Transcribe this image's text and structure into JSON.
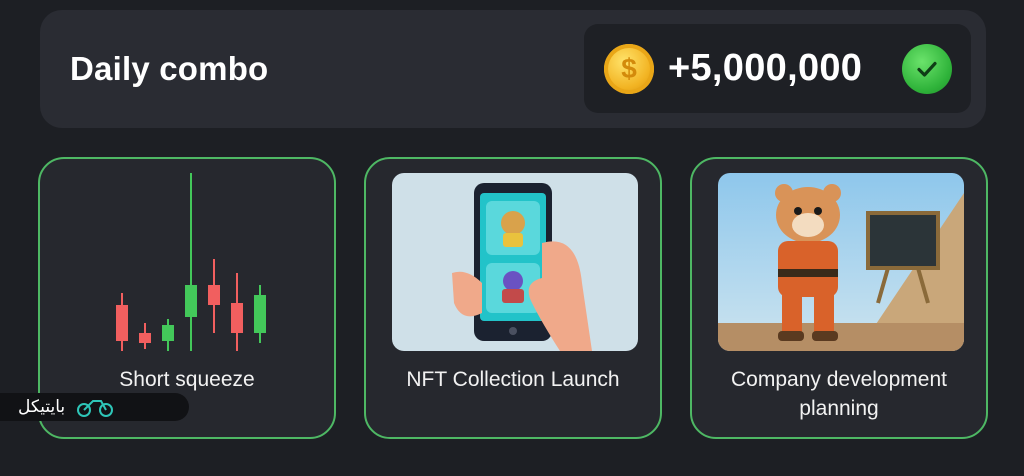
{
  "header": {
    "title": "Daily combo",
    "reward_amount": "+5,000,000",
    "coin_icon": "dollar-coin-icon",
    "status_icon": "check-circle-icon",
    "status_color": "#3cc24a"
  },
  "cards": [
    {
      "label": "Short squeeze",
      "image": "candlestick-chart"
    },
    {
      "label": "NFT Collection Launch",
      "image": "phone-nft-illustration"
    },
    {
      "label": "Company development planning",
      "image": "hamster-ceo-illustration"
    }
  ],
  "colors": {
    "accent_border": "#4eb864",
    "candle_up": "#43c85a",
    "candle_down": "#f15f5f"
  },
  "watermark": {
    "text": "بایتیکل"
  }
}
